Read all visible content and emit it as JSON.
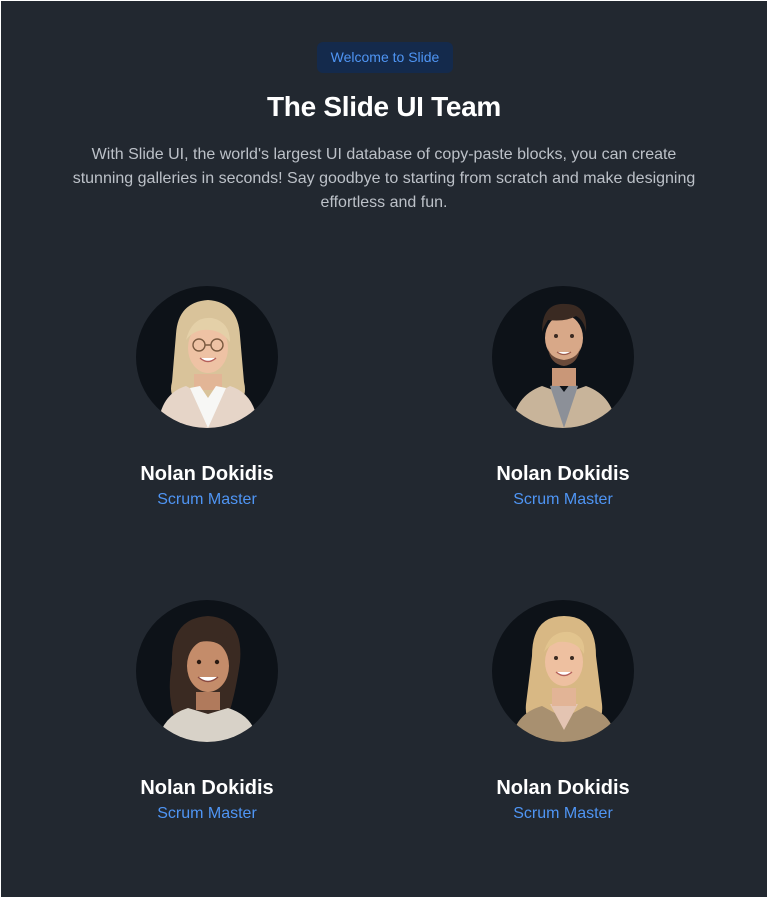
{
  "header": {
    "badge": "Welcome to Slide",
    "title": "The Slide UI Team",
    "description": "With Slide UI, the world's largest UI database of copy-paste blocks, you can create stunning galleries in seconds! Say goodbye to starting from scratch and make designing effortless and fun."
  },
  "team": [
    {
      "name": "Nolan Dokidis",
      "role": "Scrum Master"
    },
    {
      "name": "Nolan Dokidis",
      "role": "Scrum Master"
    },
    {
      "name": "Nolan Dokidis",
      "role": "Scrum Master"
    },
    {
      "name": "Nolan Dokidis",
      "role": "Scrum Master"
    }
  ],
  "colors": {
    "background": "#222830",
    "accent": "#4f95f4",
    "badge_background": "#142a4c",
    "avatar_background": "#0d1218"
  }
}
